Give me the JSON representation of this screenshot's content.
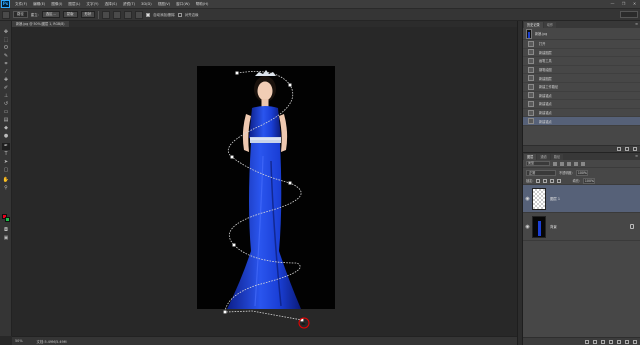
{
  "app": {
    "logo": "Ps"
  },
  "menu": {
    "items": [
      "文件(F)",
      "编辑(E)",
      "图像(I)",
      "图层(L)",
      "文字(Y)",
      "选择(S)",
      "滤镜(T)",
      "3D(D)",
      "视图(V)",
      "窗口(W)",
      "帮助(H)"
    ]
  },
  "window_controls": {
    "minimize": "—",
    "restore": "❐",
    "close": "✕"
  },
  "options": {
    "tool_mode": "路径",
    "make_label": "建立:",
    "selection_btn": "选区...",
    "mask_btn": "蒙版",
    "shape_btn": "形状",
    "auto_add_delete": "自动添加/删除",
    "align_edges": "对齐边缘"
  },
  "document": {
    "tab_title": "新娘.jpg @ 50%(图层 1, RGB/8)"
  },
  "status": {
    "zoom": "50%",
    "doc_size": "文档:5.49M/5.49M"
  },
  "history": {
    "tabs": [
      "历史记录",
      "动作"
    ],
    "snapshot": "新娘.jpg",
    "items": [
      "打开",
      "新建图层",
      "画笔工具",
      "钢笔绘图",
      "新建图层",
      "新建工作路径",
      "新建锚点",
      "新建锚点",
      "新建锚点",
      "新建锚点"
    ],
    "selected_index": 9
  },
  "layers": {
    "tabs": [
      "图层",
      "通道",
      "路径"
    ],
    "filter_kind": "类型",
    "blend_mode": "正常",
    "opacity_label": "不透明度:",
    "opacity": "100%",
    "lock_label": "锁定:",
    "fill_label": "填充:",
    "fill": "100%",
    "rows": [
      {
        "name": "图层 1",
        "selected": true,
        "thumb": "transparent"
      },
      {
        "name": "背景",
        "selected": false,
        "thumb": "photo"
      }
    ]
  },
  "colors": {
    "foreground": "#e8001c",
    "background": "#1cc04a",
    "accent_selected": "#566178",
    "dress": "#1b3fd6"
  },
  "icons": [
    "move-icon",
    "marquee-icon",
    "lasso-icon",
    "quick-select-icon",
    "crop-icon",
    "eyedropper-icon",
    "healing-icon",
    "brush-icon",
    "stamp-icon",
    "history-brush-icon",
    "eraser-icon",
    "gradient-icon",
    "blur-icon",
    "dodge-icon",
    "pen-icon",
    "type-icon",
    "path-select-icon",
    "shape-icon",
    "hand-icon",
    "zoom-icon"
  ]
}
